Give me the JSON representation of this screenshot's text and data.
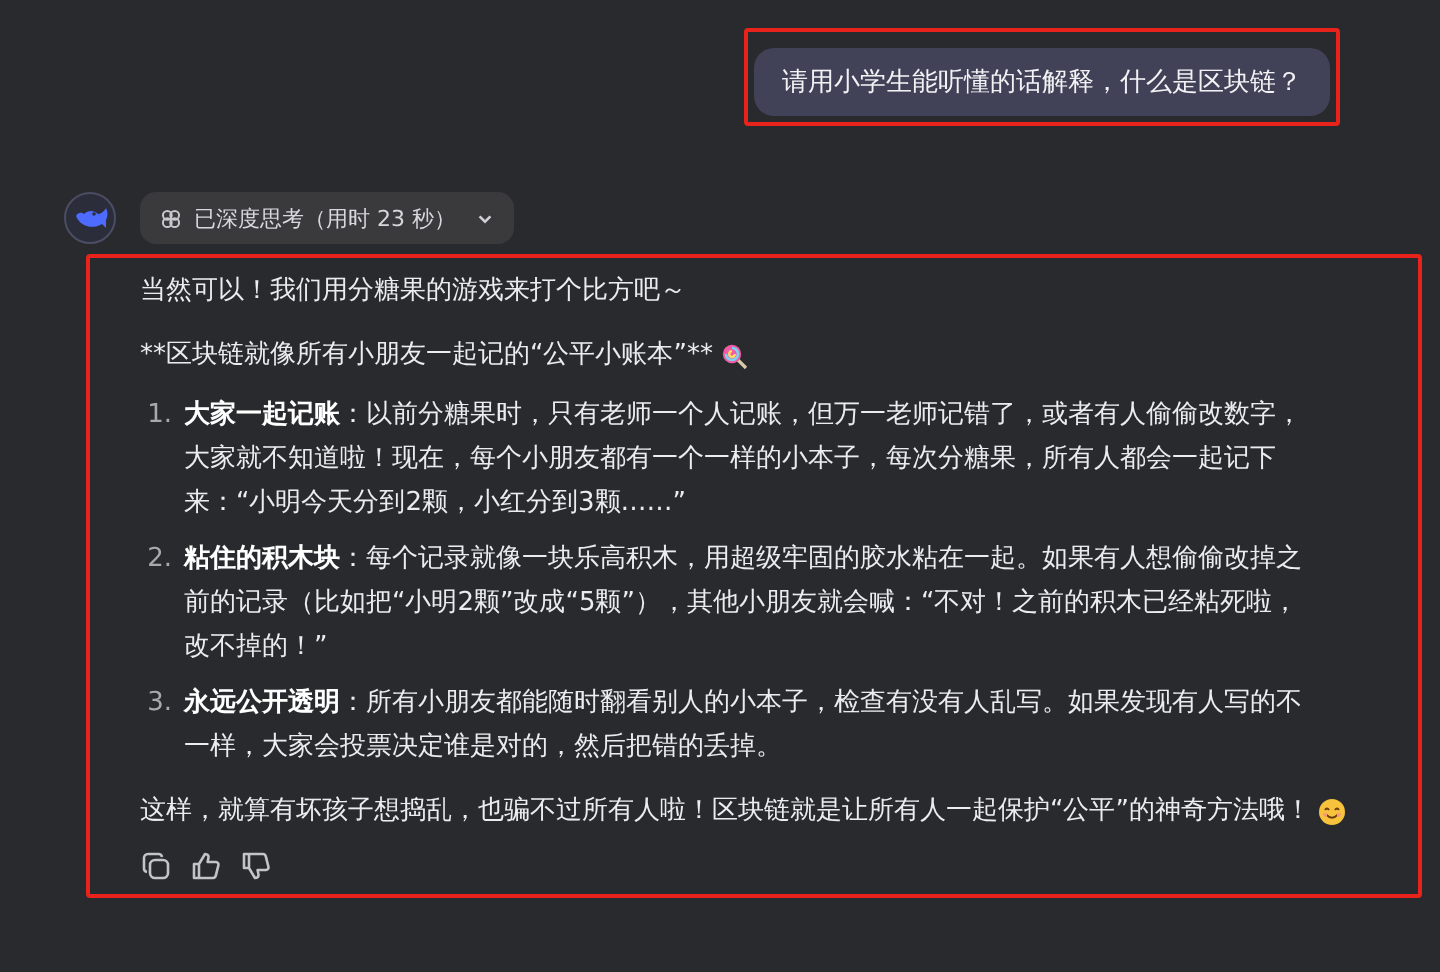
{
  "user_message": "请用小学生能听懂的话解释，什么是区块链？",
  "thinking": {
    "label": "已深度思考（用时 23 秒）",
    "expanded": false
  },
  "answer": {
    "intro": "当然可以！我们用分糖果的游戏来打个比方吧～",
    "heading": "**区块链就像所有小朋友一起记的“公平小账本”**",
    "items": [
      {
        "marker": "1.",
        "title": "大家一起记账",
        "text": "：以前分糖果时，只有老师一个人记账，但万一老师记错了，或者有人偷偷改数字，大家就不知道啦！现在，每个小朋友都有一个一样的小本子，每次分糖果，所有人都会一起记下来：“小明今天分到2颗，小红分到3颗……”"
      },
      {
        "marker": "2.",
        "title": "粘住的积木块",
        "text": "：每个记录就像一块乐高积木，用超级牢固的胶水粘在一起。如果有人想偷偷改掉之前的记录（比如把“小明2颗”改成“5颗”），其他小朋友就会喊：“不对！之前的积木已经粘死啦，改不掉的！”"
      },
      {
        "marker": "3.",
        "title": "永远公开透明",
        "text": "：所有小朋友都能随时翻看别人的小本子，检查有没有人乱写。如果发现有人写的不一样，大家会投票决定谁是对的，然后把错的丢掉。"
      }
    ],
    "conclusion": "这样，就算有坏孩子想捣乱，也骗不过所有人啦！区块链就是让所有人一起保护“公平”的神奇方法哦！"
  }
}
